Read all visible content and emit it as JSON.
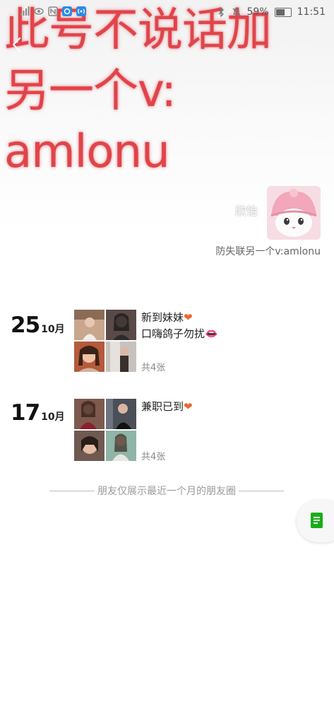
{
  "status_bar": {
    "battery": "59%",
    "time": "11:51"
  },
  "cover": {
    "lines": [
      "此号不说话加",
      "另一个v:",
      "amlonu"
    ]
  },
  "profile": {
    "name": "欣怡",
    "signature": "防失联另一个v:amlonu"
  },
  "posts": [
    {
      "day": "25",
      "month": "10月",
      "text_line1": "新到妹妹",
      "emoji1": "❤",
      "text_line2": "口嗨鸽子勿扰",
      "emoji2": "👄",
      "count": "共4张"
    },
    {
      "day": "17",
      "month": "10月",
      "text_line1": "兼职已到",
      "emoji1": "❤",
      "count": "共4张"
    }
  ],
  "footer_note": "朋友仅展示最近一个月的朋友圈",
  "icons": {
    "back": "back-icon",
    "floating": "document-icon"
  },
  "colors": {
    "cover_text": "#e0444a",
    "accent_green": "#1aad19"
  }
}
